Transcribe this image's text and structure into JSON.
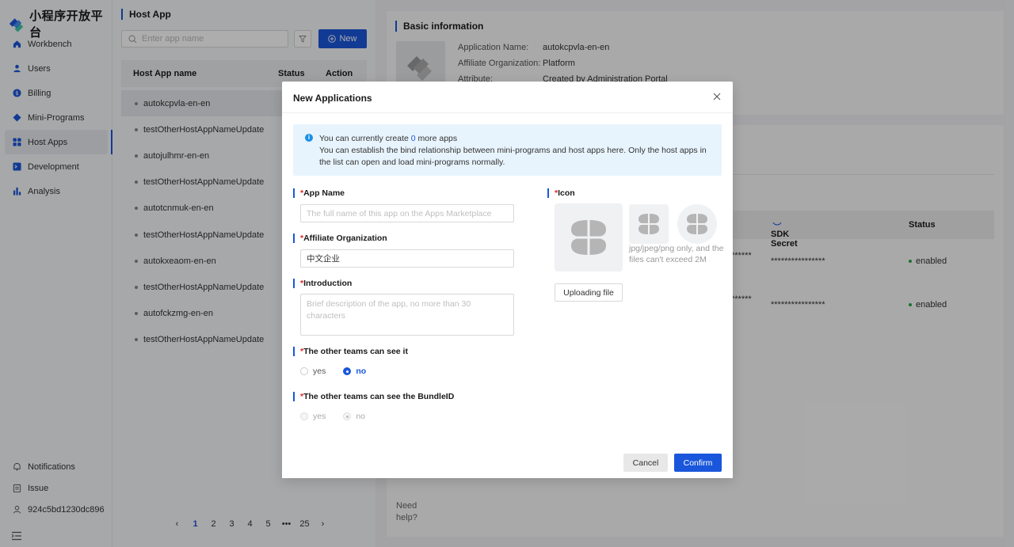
{
  "brand": {
    "name": "小程序开放平台",
    "accent": "#1a56db"
  },
  "sidebar": {
    "items": [
      {
        "label": "Workbench",
        "icon": "home-icon"
      },
      {
        "label": "Users",
        "icon": "user-icon"
      },
      {
        "label": "Billing",
        "icon": "billing-icon"
      },
      {
        "label": "Mini-Programs",
        "icon": "diamond-icon"
      },
      {
        "label": "Host Apps",
        "icon": "grid-icon",
        "active": true
      },
      {
        "label": "Development",
        "icon": "terminal-icon"
      },
      {
        "label": "Analysis",
        "icon": "bar-chart-icon"
      }
    ],
    "bottom": [
      {
        "label": "Notifications",
        "icon": "bell-icon"
      },
      {
        "label": "Issue",
        "icon": "clipboard-icon"
      },
      {
        "label": "924c5bd1230dc896",
        "icon": "person-icon"
      }
    ]
  },
  "list": {
    "title": "Host App",
    "search_placeholder": "Enter app name",
    "new_label": "New",
    "columns": {
      "name": "Host App name",
      "status": "Status",
      "action": "Action"
    },
    "rows": [
      "autokcpvla-en-en",
      "testOtherHostAppNameUpdate",
      "autojulhmr-en-en",
      "testOtherHostAppNameUpdate",
      "autotcnmuk-en-en",
      "testOtherHostAppNameUpdate",
      "autokxeaom-en-en",
      "testOtherHostAppNameUpdate",
      "autofckzmg-en-en",
      "testOtherHostAppNameUpdate"
    ],
    "pager": [
      "1",
      "2",
      "3",
      "4",
      "5",
      "•••",
      "25"
    ]
  },
  "detail": {
    "title": "Basic information",
    "fields": [
      {
        "key": "Application Name:",
        "value": "autokcpvla-en-en"
      },
      {
        "key": "Affiliate Organization:",
        "value": "Platform"
      },
      {
        "key": "Attribute:",
        "value": "Created by Administration Portal"
      }
    ],
    "sdk_columns": {
      "secret": "SDK Secret",
      "status": "Status"
    },
    "sdk_rows": [
      {
        "key_tail": "******",
        "secret": "****************",
        "status": "enabled"
      },
      {
        "key_tail": "******",
        "secret": "****************",
        "status": "enabled"
      }
    ],
    "need_help": "Need help?"
  },
  "modal": {
    "title": "New Applications",
    "info_prefix": "You can currently create ",
    "info_count": "0",
    "info_suffix": " more apps",
    "info_line2": "You can establish the bind relationship between mini-programs and host apps here. Only the host apps in the list can open and load mini-programs normally.",
    "required_mark": "*",
    "app_name_label": "App Name",
    "app_name_placeholder": "The full name of this app on the Apps Marketplace",
    "org_label": "Affiliate Organization",
    "org_value": "中文企业",
    "intro_label": "Introduction",
    "intro_placeholder": "Brief description of the app, no more than 30 characters",
    "visible_label": "The other teams can see it",
    "bundle_label": "The other teams can see the BundleID",
    "yes": "yes",
    "no": "no",
    "icon_label": "Icon",
    "icon_hint": "jpg/jpeg/png only, and the files can't exceed 2M",
    "upload_label": "Uploading file",
    "cancel_label": "Cancel",
    "confirm_label": "Confirm"
  }
}
